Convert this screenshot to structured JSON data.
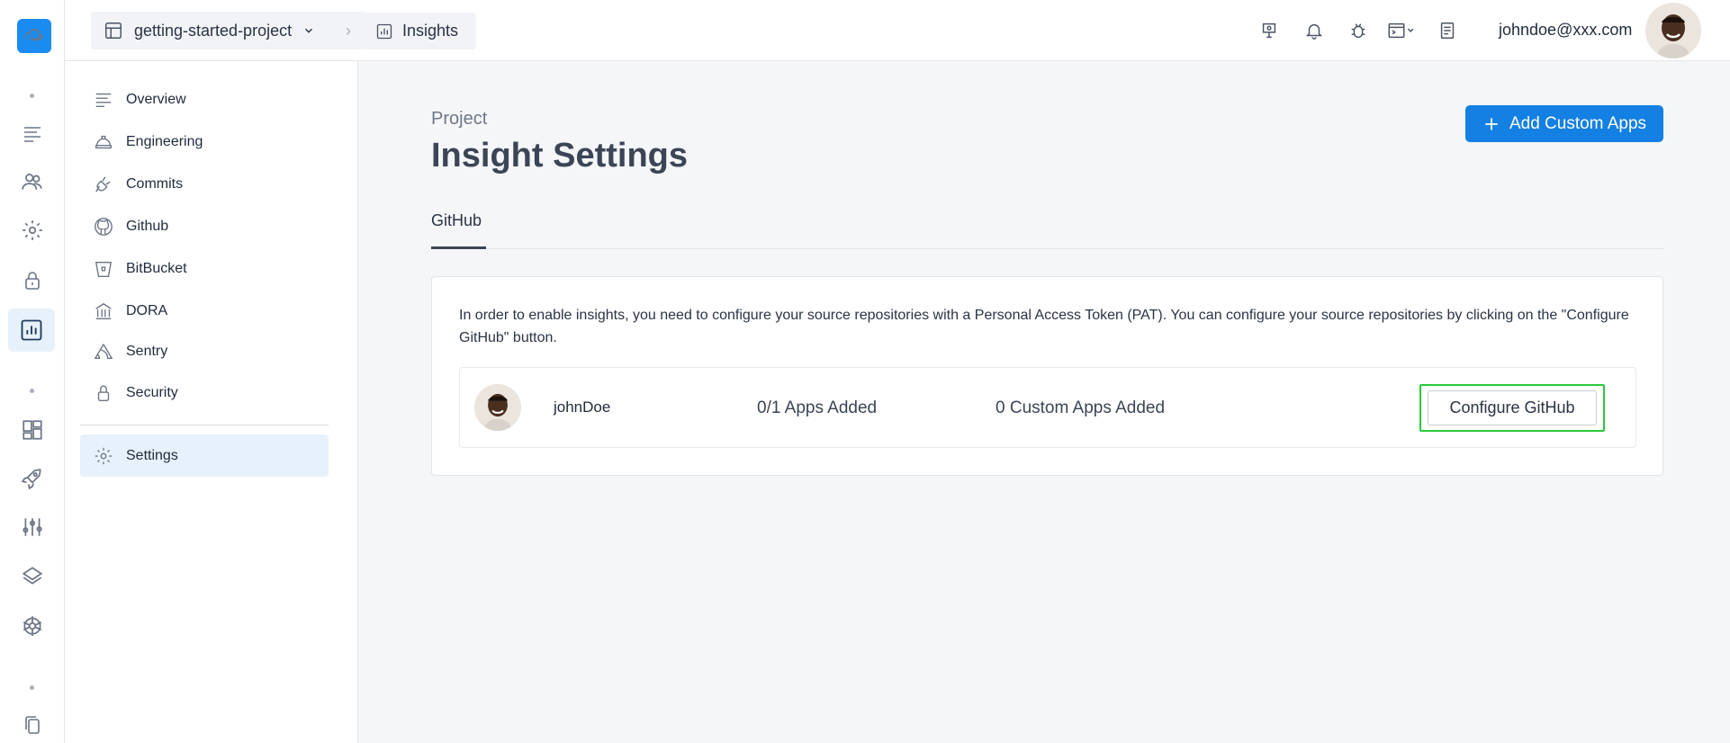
{
  "topbar": {
    "project": "getting-started-project",
    "section": "Insights",
    "email": "johndoe@xxx.com",
    "icons": [
      "monitor-pin-icon",
      "bell-icon",
      "bug-icon",
      "terminal-window-icon",
      "document-icon"
    ]
  },
  "nav": {
    "items": [
      {
        "label": "Overview",
        "icon": "lines-icon"
      },
      {
        "label": "Engineering",
        "icon": "hardhat-icon"
      },
      {
        "label": "Commits",
        "icon": "plug-icon"
      },
      {
        "label": "Github",
        "icon": "github-icon"
      },
      {
        "label": "BitBucket",
        "icon": "bucket-icon"
      },
      {
        "label": "DORA",
        "icon": "bank-icon"
      },
      {
        "label": "Sentry",
        "icon": "sentry-icon"
      },
      {
        "label": "Security",
        "icon": "lock-icon"
      },
      {
        "label": "Settings",
        "icon": "gear-icon"
      }
    ]
  },
  "main": {
    "eyebrow": "Project",
    "title": "Insight Settings",
    "add_button": "Add Custom Apps",
    "tab": "GitHub",
    "description": "In order to enable insights, you need to configure your source repositories with a Personal Access Token (PAT). You can configure your source repositories by clicking on the \"Configure GitHub\" button.",
    "row": {
      "username": "johnDoe",
      "apps_added": "0/1 Apps Added",
      "custom_added": "0 Custom Apps Added",
      "configure_button": "Configure GitHub"
    }
  },
  "colors": {
    "accent": "#1580e3",
    "highlight_outline": "#2bc93a",
    "active_bg": "#e7f1fb"
  }
}
